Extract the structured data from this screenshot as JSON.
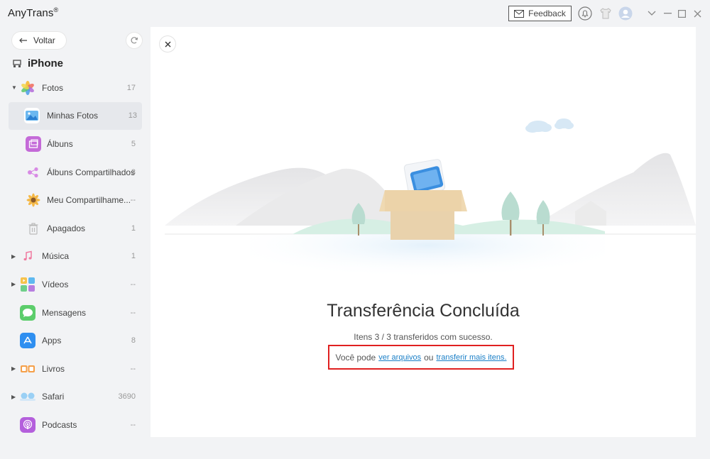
{
  "app": {
    "title": "AnyTrans",
    "title_mark": "®"
  },
  "titlebar": {
    "feedback_label": "Feedback"
  },
  "sidebar": {
    "back_label": "Voltar",
    "device_name": "iPhone",
    "items": [
      {
        "label": "Fotos",
        "count": "17"
      },
      {
        "label": "Minhas Fotos",
        "count": "13"
      },
      {
        "label": "Álbuns",
        "count": "5"
      },
      {
        "label": "Álbuns Compartilhados",
        "count": "3"
      },
      {
        "label": "Meu Compartilhame...",
        "count": "--"
      },
      {
        "label": "Apagados",
        "count": "1"
      },
      {
        "label": "Música",
        "count": "1"
      },
      {
        "label": "Vídeos",
        "count": "--"
      },
      {
        "label": "Mensagens",
        "count": "--"
      },
      {
        "label": "Apps",
        "count": "8"
      },
      {
        "label": "Livros",
        "count": "--"
      },
      {
        "label": "Safari",
        "count": "3690"
      },
      {
        "label": "Podcasts",
        "count": "--"
      }
    ]
  },
  "main": {
    "title": "Transferência Concluída",
    "subtitle": "Itens 3 / 3 transferidos com sucesso.",
    "hint_prefix": "Você pode",
    "link_view": "ver arquivos",
    "hint_middle": "ou",
    "link_more": "transferir mais itens."
  },
  "colors": {
    "accent": "#1a7fc7",
    "highlight_border": "#e02020"
  }
}
